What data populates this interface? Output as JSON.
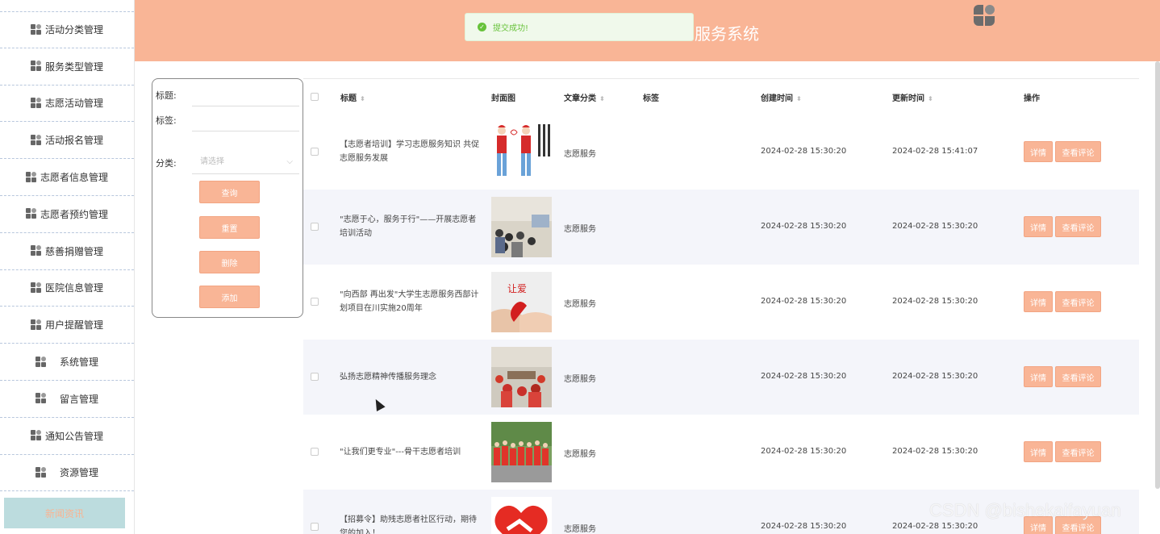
{
  "sidebar": {
    "items": [
      {
        "label": "活动分类管理"
      },
      {
        "label": "服务类型管理"
      },
      {
        "label": "志愿活动管理"
      },
      {
        "label": "活动报名管理"
      },
      {
        "label": "志愿者信息管理"
      },
      {
        "label": "志愿者预约管理"
      },
      {
        "label": "慈善捐赠管理"
      },
      {
        "label": "医院信息管理"
      },
      {
        "label": "用户提醒管理"
      },
      {
        "label": "系统管理"
      },
      {
        "label": "留言管理"
      },
      {
        "label": "通知公告管理"
      },
      {
        "label": "资源管理"
      }
    ],
    "bottom_label": "新闻资讯"
  },
  "header": {
    "title": "服务系统",
    "background": "#f9b596"
  },
  "toast": {
    "message": "提交成功!",
    "type": "success"
  },
  "search_form": {
    "title_label": "标题:",
    "tag_label": "标签:",
    "category_label": "分类:",
    "category_placeholder": "请选择",
    "query_button": "查询",
    "reset_button": "重置",
    "delete_button": "删除",
    "add_button": "添加"
  },
  "table": {
    "headers": {
      "title": "标题",
      "cover": "封面图",
      "category": "文章分类",
      "tags": "标签",
      "created": "创建时间",
      "updated": "更新时间",
      "actions": "操作"
    },
    "detail_label": "详情",
    "comment_label": "查看评论",
    "rows": [
      {
        "title": "【志愿者培训】学习志愿服务知识 共促志愿服务发展",
        "category": "志愿服务",
        "created": "2024-02-28 15:30:20",
        "updated": "2024-02-28 15:41:07"
      },
      {
        "title": "\"志愿于心，服务于行\"——开展志愿者培训活动",
        "category": "志愿服务",
        "created": "2024-02-28 15:30:20",
        "updated": "2024-02-28 15:30:20"
      },
      {
        "title": "\"向西部 再出发\"大学生志愿服务西部计划项目在川实施20周年",
        "category": "志愿服务",
        "created": "2024-02-28 15:30:20",
        "updated": "2024-02-28 15:30:20"
      },
      {
        "title": "弘扬志愿精神传播服务理念",
        "category": "志愿服务",
        "created": "2024-02-28 15:30:20",
        "updated": "2024-02-28 15:30:20"
      },
      {
        "title": "\"让我们更专业\"---骨干志愿者培训",
        "category": "志愿服务",
        "created": "2024-02-28 15:30:20",
        "updated": "2024-02-28 15:30:20"
      },
      {
        "title": "【招募令】助残志愿者社区行动，期待您的加入！",
        "category": "志愿服务",
        "created": "2024-02-28 15:30:20",
        "updated": "2024-02-28 15:30:20"
      }
    ]
  },
  "watermark": "CSDN @bishekaifayuan"
}
